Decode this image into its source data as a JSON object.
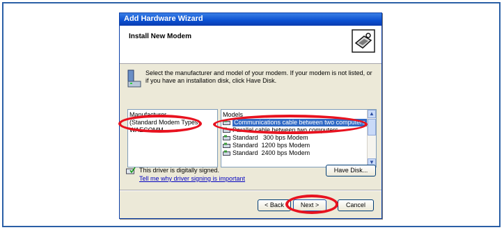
{
  "window": {
    "title": "Add Hardware Wizard"
  },
  "header": {
    "title": "Install New Modem",
    "icon": "hardware-wizard-icon"
  },
  "description": "Select the manufacturer and model of your modem. If your modem is not listed, or if you have an installation disk, click Have Disk.",
  "manufacturer": {
    "label": "Manufacturer",
    "items": [
      {
        "label": "(Standard Modem Types)",
        "selected": true
      },
      {
        "label": "WAECOMM",
        "selected": false
      }
    ]
  },
  "models": {
    "label": "Models",
    "items": [
      {
        "label": "Communications cable between two computers",
        "selected": true
      },
      {
        "label": "Parallel cable between two computers",
        "selected": false
      },
      {
        "label": "Standard   300 bps Modem",
        "selected": false
      },
      {
        "label": "Standard  1200 bps Modem",
        "selected": false
      },
      {
        "label": "Standard  2400 bps Modem",
        "selected": false
      }
    ]
  },
  "signature": {
    "text": "This driver is digitally signed.",
    "link": "Tell me why driver signing is important"
  },
  "buttons": {
    "have_disk": "Have Disk...",
    "back": "< Back",
    "next": "Next >",
    "cancel": "Cancel"
  },
  "colors": {
    "highlight": "#e8121f",
    "selection": "#316ac5",
    "title_bar": "#0a4fd0"
  }
}
